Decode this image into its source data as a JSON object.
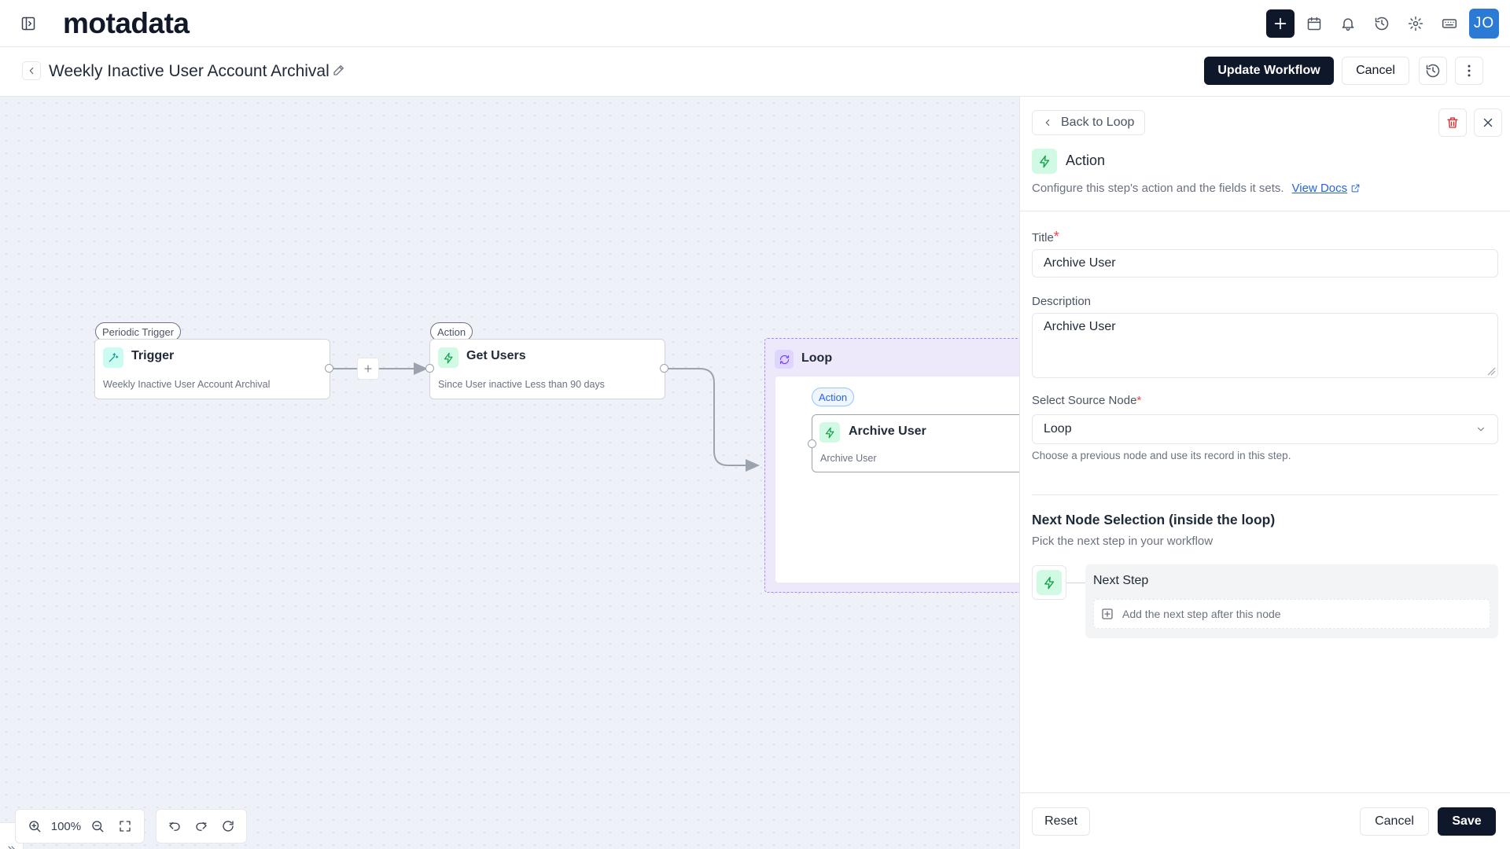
{
  "header": {
    "logo": "motadata",
    "avatar_initials": "JO",
    "icons": [
      "sidebar-toggle-icon",
      "plus-icon",
      "calendar-icon",
      "bell-icon",
      "history-icon",
      "gear-icon",
      "keyboard-icon"
    ]
  },
  "subheader": {
    "title": "Weekly Inactive User Account Archival",
    "update_label": "Update Workflow",
    "cancel_label": "Cancel"
  },
  "canvas": {
    "zoom": "100%",
    "nodes": {
      "trigger": {
        "chip": "Periodic Trigger",
        "title": "Trigger",
        "desc": "Weekly Inactive User Account Archival"
      },
      "get_users": {
        "chip": "Action",
        "title": "Get Users",
        "desc": "Since User inactive Less than 90 days"
      },
      "loop": {
        "title": "Loop"
      },
      "archive": {
        "chip": "Action",
        "title": "Archive User",
        "desc": "Archive User"
      }
    }
  },
  "panel": {
    "back_label": "Back to Loop",
    "title": "Action",
    "subtitle": "Configure this step's action and the fields it sets.",
    "docs_link": "View Docs",
    "title_label": "Title",
    "title_value": "Archive User",
    "desc_label": "Description",
    "desc_value": "Archive User",
    "source_label": "Select Source Node",
    "source_value": "Loop",
    "source_help": "Choose a previous node and use its record in this step.",
    "next_title": "Next Node Selection (inside the loop)",
    "next_sub": "Pick the next step in your workflow",
    "next_step_label": "Next Step",
    "add_next_label": "Add the next step after this node",
    "reset_label": "Reset",
    "cancel_label": "Cancel",
    "save_label": "Save"
  },
  "colors": {
    "primary_dark": "#0f172a",
    "action_green": "#16a34a",
    "loop_purple": "#7c3aed",
    "link_blue": "#2563eb",
    "danger_red": "#dc2626",
    "avatar_blue": "#2b7bd6"
  }
}
